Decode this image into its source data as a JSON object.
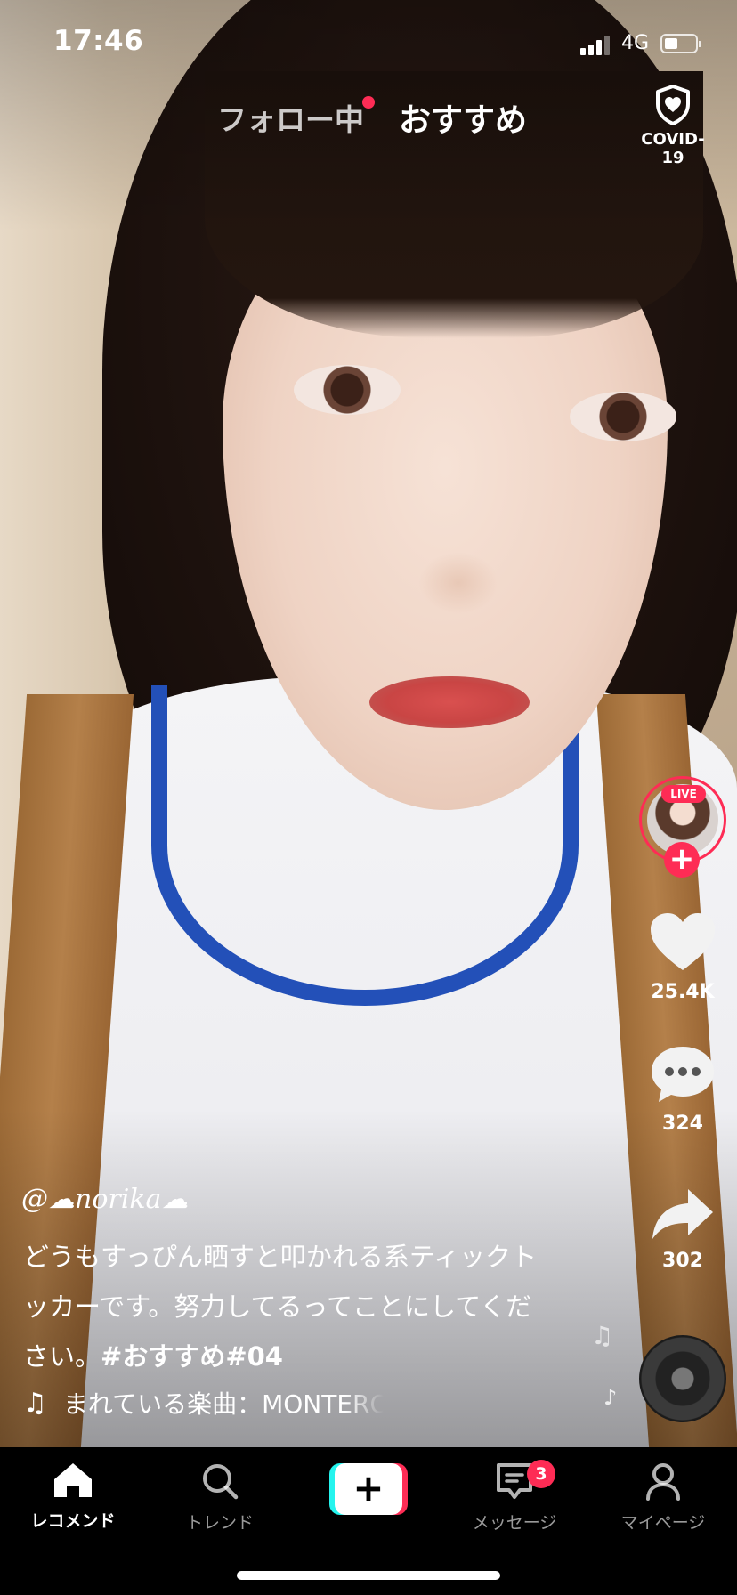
{
  "status": {
    "time": "17:46",
    "network": "4G",
    "battery_level": 0.45
  },
  "top_tabs": {
    "following": "フォロー中",
    "recommended": "おすすめ"
  },
  "covid": {
    "label": "COVID-19"
  },
  "creator": {
    "live_label": "LIVE",
    "follow_symbol": "+"
  },
  "actions": {
    "likes": "25.4K",
    "comments": "324",
    "shares": "302"
  },
  "caption": {
    "username": "@☁norika☁",
    "text": "どうもすっぴん晒すと叩かれる系ティックトッカーです。努力してるってことにしてください。",
    "hashtags": "#おすすめ#04",
    "music": "まれている楽曲：MONTERO"
  },
  "nav": {
    "home": "レコメンド",
    "trend": "トレンド",
    "create_symbol": "+",
    "messages": "メッセージ",
    "messages_badge": "3",
    "me": "マイページ"
  },
  "colors": {
    "accent": "#fe2c55",
    "cyan": "#25f4ee",
    "nav_bg": "#000000"
  }
}
